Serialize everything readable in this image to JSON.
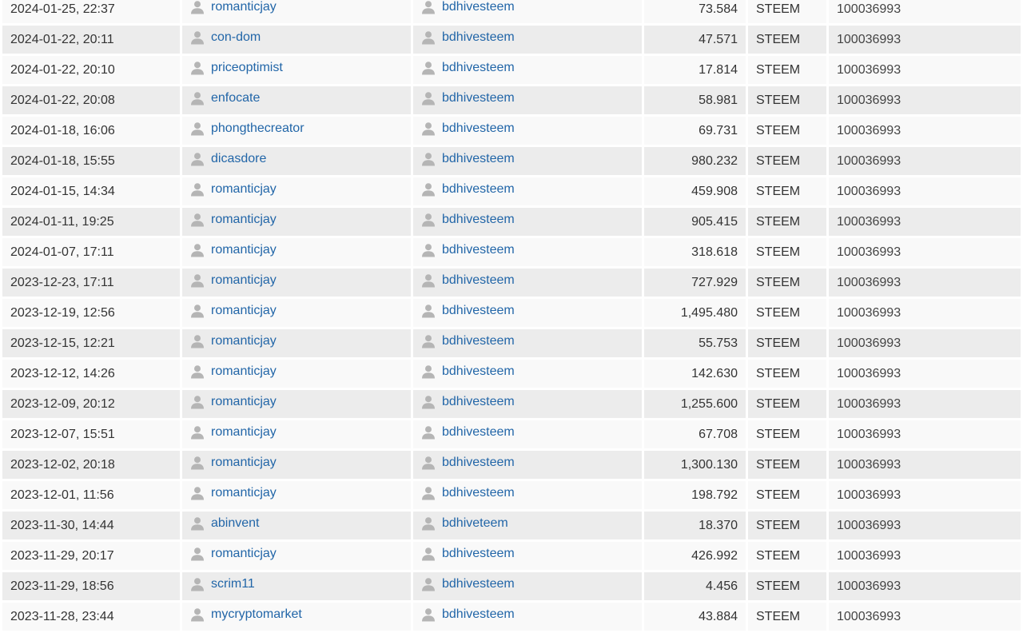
{
  "colors": {
    "link": "#2266a8",
    "row_odd": "#f9f9f9",
    "row_even": "#ececec",
    "icon": "#b5b5b5"
  },
  "icon": "user-silhouette-icon",
  "transfers": [
    {
      "date": "2024-01-25, 22:37",
      "from": "romanticjay",
      "to": "bdhivesteem",
      "amount": "73.584",
      "asset": "STEEM",
      "memo": "100036993"
    },
    {
      "date": "2024-01-22, 20:11",
      "from": "con-dom",
      "to": "bdhivesteem",
      "amount": "47.571",
      "asset": "STEEM",
      "memo": "100036993"
    },
    {
      "date": "2024-01-22, 20:10",
      "from": "priceoptimist",
      "to": "bdhivesteem",
      "amount": "17.814",
      "asset": "STEEM",
      "memo": "100036993"
    },
    {
      "date": "2024-01-22, 20:08",
      "from": "enfocate",
      "to": "bdhivesteem",
      "amount": "58.981",
      "asset": "STEEM",
      "memo": "100036993"
    },
    {
      "date": "2024-01-18, 16:06",
      "from": "phongthecreator",
      "to": "bdhivesteem",
      "amount": "69.731",
      "asset": "STEEM",
      "memo": "100036993"
    },
    {
      "date": "2024-01-18, 15:55",
      "from": "dicasdore",
      "to": "bdhivesteem",
      "amount": "980.232",
      "asset": "STEEM",
      "memo": "100036993"
    },
    {
      "date": "2024-01-15, 14:34",
      "from": "romanticjay",
      "to": "bdhivesteem",
      "amount": "459.908",
      "asset": "STEEM",
      "memo": "100036993"
    },
    {
      "date": "2024-01-11, 19:25",
      "from": "romanticjay",
      "to": "bdhivesteem",
      "amount": "905.415",
      "asset": "STEEM",
      "memo": "100036993"
    },
    {
      "date": "2024-01-07, 17:11",
      "from": "romanticjay",
      "to": "bdhivesteem",
      "amount": "318.618",
      "asset": "STEEM",
      "memo": "100036993"
    },
    {
      "date": "2023-12-23, 17:11",
      "from": "romanticjay",
      "to": "bdhivesteem",
      "amount": "727.929",
      "asset": "STEEM",
      "memo": "100036993"
    },
    {
      "date": "2023-12-19, 12:56",
      "from": "romanticjay",
      "to": "bdhivesteem",
      "amount": "1,495.480",
      "asset": "STEEM",
      "memo": "100036993"
    },
    {
      "date": "2023-12-15, 12:21",
      "from": "romanticjay",
      "to": "bdhivesteem",
      "amount": "55.753",
      "asset": "STEEM",
      "memo": "100036993"
    },
    {
      "date": "2023-12-12, 14:26",
      "from": "romanticjay",
      "to": "bdhivesteem",
      "amount": "142.630",
      "asset": "STEEM",
      "memo": "100036993"
    },
    {
      "date": "2023-12-09, 20:12",
      "from": "romanticjay",
      "to": "bdhivesteem",
      "amount": "1,255.600",
      "asset": "STEEM",
      "memo": "100036993"
    },
    {
      "date": "2023-12-07, 15:51",
      "from": "romanticjay",
      "to": "bdhivesteem",
      "amount": "67.708",
      "asset": "STEEM",
      "memo": "100036993"
    },
    {
      "date": "2023-12-02, 20:18",
      "from": "romanticjay",
      "to": "bdhivesteem",
      "amount": "1,300.130",
      "asset": "STEEM",
      "memo": "100036993"
    },
    {
      "date": "2023-12-01, 11:56",
      "from": "romanticjay",
      "to": "bdhivesteem",
      "amount": "198.792",
      "asset": "STEEM",
      "memo": "100036993"
    },
    {
      "date": "2023-11-30, 14:44",
      "from": "abinvent",
      "to": "bdhiveteem",
      "amount": "18.370",
      "asset": "STEEM",
      "memo": "100036993"
    },
    {
      "date": "2023-11-29, 20:17",
      "from": "romanticjay",
      "to": "bdhivesteem",
      "amount": "426.992",
      "asset": "STEEM",
      "memo": "100036993"
    },
    {
      "date": "2023-11-29, 18:56",
      "from": "scrim11",
      "to": "bdhivesteem",
      "amount": "4.456",
      "asset": "STEEM",
      "memo": "100036993"
    },
    {
      "date": "2023-11-28, 23:44",
      "from": "mycryptomarket",
      "to": "bdhivesteem",
      "amount": "43.884",
      "asset": "STEEM",
      "memo": "100036993"
    }
  ]
}
